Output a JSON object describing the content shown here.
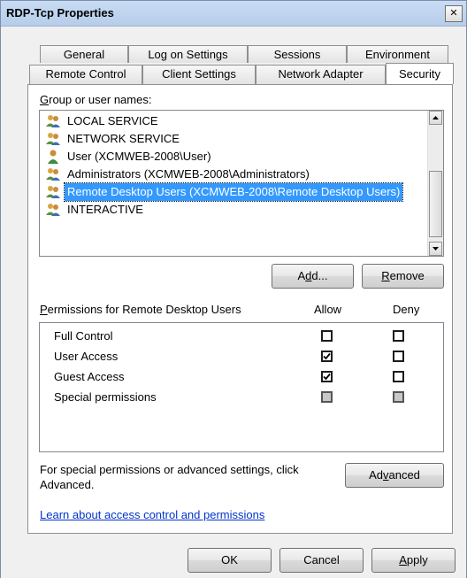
{
  "window": {
    "title": "RDP-Tcp Properties",
    "close_glyph": "✕"
  },
  "tabs_row1": [
    {
      "label": "General"
    },
    {
      "label": "Log on Settings"
    },
    {
      "label": "Sessions"
    },
    {
      "label": "Environment"
    }
  ],
  "tabs_row2": [
    {
      "label": "Remote Control"
    },
    {
      "label": "Client Settings"
    },
    {
      "label": "Network Adapter"
    },
    {
      "label": "Security",
      "selected": true
    }
  ],
  "group_section": {
    "label_prefix": "",
    "label_accel": "G",
    "label_rest": "roup or user names:",
    "items": [
      {
        "name": "LOCAL SERVICE",
        "icon": "group-icon"
      },
      {
        "name": "NETWORK SERVICE",
        "icon": "group-icon"
      },
      {
        "name": "User (XCMWEB-2008\\User)",
        "icon": "user-icon"
      },
      {
        "name": "Administrators (XCMWEB-2008\\Administrators)",
        "icon": "group-icon"
      },
      {
        "name": "Remote Desktop Users (XCMWEB-2008\\Remote Desktop Users)",
        "icon": "group-icon",
        "selected": true
      },
      {
        "name": "INTERACTIVE",
        "icon": "group-icon"
      }
    ],
    "add_button": {
      "pre": "A",
      "accel": "d",
      "post": "d..."
    },
    "remove_button": {
      "pre": "",
      "accel": "R",
      "post": "emove"
    }
  },
  "permissions": {
    "label_accel": "P",
    "label_rest": "ermissions for Remote Desktop Users",
    "allow_header": "Allow",
    "deny_header": "Deny",
    "rows": [
      {
        "name": "Full Control",
        "allow": false,
        "deny": false,
        "enabled": true
      },
      {
        "name": "User Access",
        "allow": true,
        "deny": false,
        "enabled": true
      },
      {
        "name": "Guest Access",
        "allow": true,
        "deny": false,
        "enabled": true
      },
      {
        "name": "Special permissions",
        "allow": false,
        "deny": false,
        "enabled": false
      }
    ]
  },
  "advanced": {
    "text_line1": "For special permissions or advanced settings, click",
    "text_line2": "Advanced.",
    "button": {
      "pre": "Ad",
      "accel": "v",
      "post": "anced"
    }
  },
  "link": {
    "text": "Learn about access control and permissions"
  },
  "footer": {
    "ok": "OK",
    "cancel": "Cancel",
    "apply": {
      "pre": "",
      "accel": "A",
      "post": "pply"
    }
  },
  "colors": {
    "selection": "#3399ff",
    "link": "#0033cc",
    "title_bar": "#c9dcf5"
  }
}
